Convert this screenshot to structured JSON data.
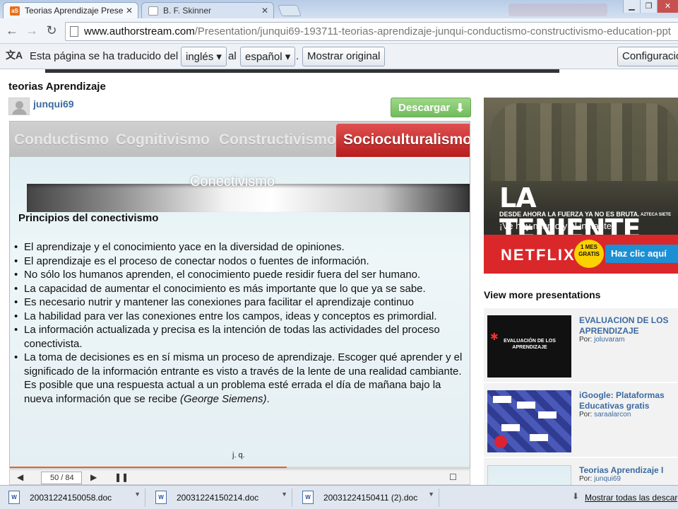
{
  "browser": {
    "tabs": [
      {
        "title": "Teorias Aprendizaje Prese",
        "favicon": "aS",
        "active": true
      },
      {
        "title": "B. F. Skinner",
        "favicon": "",
        "active": false
      }
    ],
    "url_host": "www.authorstream.com",
    "url_path": "/Presentation/junqui69-193711-teorias-aprendizaje-junqui-conductismo-constructivismo-education-ppt"
  },
  "translate_bar": {
    "text_before": "Esta página se ha traducido del",
    "from_lang": "inglés",
    "connector": "al",
    "to_lang": "español",
    "period": ".",
    "show_original": "Mostrar original",
    "settings": "Configuracio"
  },
  "presentation": {
    "title": "teorias Aprendizaje",
    "author": "junqui69",
    "download_label": "Descargar",
    "slide": {
      "nav_items": [
        "Conductismo",
        "Cognitivismo",
        "Constructivismo",
        "Socioculturalismo"
      ],
      "active_nav": "Socioculturalismo",
      "ribbon_text": "Conectivismo",
      "heading": "Principios del conectivismo",
      "bullets": [
        "El aprendizaje y el conocimiento yace en la diversidad de opiniones.",
        "El aprendizaje es el proceso de conectar nodos o fuentes de información.",
        "No sólo los humanos aprenden, el conocimiento puede residir fuera del ser humano.",
        "La capacidad de aumentar el conocimiento es más importante que lo que ya se sabe.",
        "Es necesario nutrir y mantener las conexiones para facilitar el aprendizaje continuo",
        "La habilidad para ver las conexiones entre los campos, ideas y conceptos es primordial.",
        "La información actualizada y precisa es la intención de todas las actividades del proceso conectivista."
      ],
      "last_bullet_main": "La toma de decisiones es en sí misma un proceso de aprendizaje. Escoger qué aprender y el significado de la información entrante es visto a través de la lente de una realidad cambiante. Es posible que una respuesta actual a un problema esté errada el día de mañana bajo la nueva información que se recibe ",
      "last_bullet_cite": "(George Siemens)",
      "last_bullet_end": ".",
      "footer": "j. q.",
      "progress": 0.6
    },
    "player": {
      "page_indicator": "50 / 84"
    }
  },
  "ad": {
    "brand": "LA TENIENTE",
    "tagline": "DESDE AHORA LA FUERZA YA NO ES BRUTA.",
    "sub": "¡Ve hoy mismo y al instante!",
    "network": "AZTECA SIETE",
    "partner": "NETFLIX",
    "badge": "1 MES GRATIS",
    "cta": "Haz clic aquí"
  },
  "sidebar": {
    "heading": "View more presentations",
    "by_label": "Por:",
    "items": [
      {
        "title": "EVALUACION DE LOS APRENDIZAJE",
        "author": "joluvaram",
        "thumb_text": "EVALUACIÓN DE LOS APRENDIZAJE"
      },
      {
        "title": "iGoogle: Plataformas Educativas gratis",
        "author": "saraalarcon",
        "thumb_text": ""
      },
      {
        "title": "Teorias Aprendizaje I",
        "author": "junqui69",
        "thumb_text": ""
      }
    ]
  },
  "downloads": {
    "items": [
      "20031224150058.doc",
      "20031224150214.doc",
      "20031224150411 (2).doc"
    ],
    "show_all": "Mostrar todas las descarg"
  },
  "colors": {
    "accent_red": "#c62a2a",
    "link_blue": "#3b6aa0",
    "download_green": "#78c062",
    "progress_orange": "#e86a24"
  }
}
